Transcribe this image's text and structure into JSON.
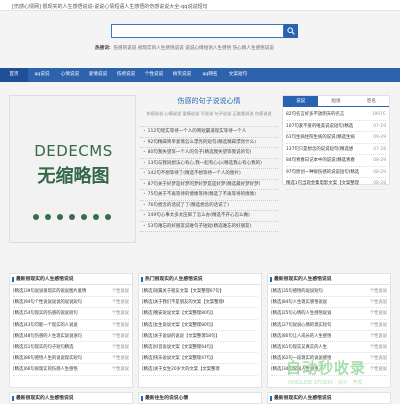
{
  "topbar": {
    "text": "[伤感心情网] 很现实的人生感悟说说-说说心情短语人生感悟的伤感说说大全-qq说说短句"
  },
  "search": {
    "placeholder": "",
    "button": "search-icon"
  },
  "hot": {
    "label": "热搜词：",
    "text": "伤感的说说 很现实的人生感悟说说 说说心情短语人生感悟 伤心情人生感悟说说"
  },
  "nav": {
    "items": [
      "首页",
      "qq说说",
      "心情说说",
      "爱情说说",
      "伤感说说",
      "个性说说",
      "搞笑说说",
      "qq网名",
      "文案短句"
    ]
  },
  "banner": {
    "line1": "DEDECMS",
    "line2": "无缩略图"
  },
  "featured": {
    "title": "伤感的句子说说心情",
    "tags": "伤感说说 心情说说 爱情说说 写说说 句子说说 正能量说说 伤感说说",
    "items": [
      "112句现实等待一个人的简短霸道现实等待一个人",
      "92句精辟简单爱情怎么漂亮的短句(精选精辟漂亮什么)",
      "80句我失望等一个人的句子(精选我失望等我说的句)",
      "13句与我同想法心有心,我一起有心心(精选我心有心我的)",
      "142句不想等待了(精选不想等待一个人的图片)",
      "87句关于好梦是好梦的梦好梦是是好梦(精选最好梦好梦)",
      "75句关于不再等待的情愫等待(精选了不再等待的情愫)",
      "76句想念的话说了了(精选想念的话说了)",
      "149句心事太多太压抑了怎么办(精选不开心怎么做)",
      "53句难忘的好朋友说难句子短短(精选难忘的好朋友)"
    ]
  },
  "side": {
    "tabs": [
      "说说",
      "短语",
      "签名"
    ],
    "items": [
      {
        "title": "82句名言好多不放明天的名言",
        "date": "1907C"
      },
      {
        "title": "107句爱不爱的唯美说说短句(精选",
        "date": "07-29"
      },
      {
        "title": "61句生病住院生病的说说(精选生病",
        "date": "09-29"
      },
      {
        "title": "137句只是想念的说说短句(精选想",
        "date": "07-28"
      },
      {
        "title": "84句青春日记本中的说说(精选青春",
        "date": "08-29"
      },
      {
        "title": "97句原创一种很伤感的说说短句(精选",
        "date": "08-29"
      },
      {
        "title": "精选1句当现金集电影文案【文案整理",
        "date": "08-28"
      }
    ]
  },
  "boxes": [
    {
      "title": "最新很现实的人生感悟说说",
      "items": [
        {
          "title": "[精选]39句说说很现实的说说图片爱情",
          "date": "个性说说"
        },
        {
          "title": "[精选]94句个性说说说说的说说短句",
          "date": "个性说说"
        },
        {
          "title": "[精选]54句现实的伤感的说说短句",
          "date": "个性说说"
        },
        {
          "title": "[精选]43句可能一个现实的人说说",
          "date": "个性说说"
        },
        {
          "title": "[精选]48句伤感的人生现实说说语句",
          "date": "个性说说"
        },
        {
          "title": "[精选]51句现实的句子短句精选",
          "date": "个性说说"
        },
        {
          "title": "[精选]86句感悟人生的说说现实短句",
          "date": "个性说说"
        },
        {
          "title": "[精选]66句很现实的伤感人生感悟",
          "date": "个性说说"
        }
      ]
    },
    {
      "title": "热门很现实的人生感悟说说",
      "items": [
        {
          "title": "[精选]短篇关于朋友文案【文案整理07句】",
          "date": ""
        },
        {
          "title": "[精选]关于我们不是朋友的文案【文案整理69句】",
          "date": ""
        },
        {
          "title": "[精选]晚安说说文案【文案整理80句】",
          "date": ""
        },
        {
          "title": "[精选]女生说说文案【文案整理80句】",
          "date": ""
        },
        {
          "title": "[精选]关于说说的说说【文案整理58句】",
          "date": ""
        },
        {
          "title": "[精选]抖音说说文案【文案整理64句】",
          "date": ""
        },
        {
          "title": "[精选]快乐说说文案【文案整理47句】",
          "date": ""
        },
        {
          "title": "[精选]关于女生20岁大的文案【文案整理",
          "date": ""
        }
      ]
    },
    {
      "title": "最新很现实的人生感悟说说",
      "items": [
        {
          "title": "[精选]35句感悟的说说短句",
          "date": "个性说说"
        },
        {
          "title": "[精选]84句人生现实感悟说说",
          "date": "个性说说"
        },
        {
          "title": "[精选]25句心情的人生感悟说说",
          "date": "个性说说"
        },
        {
          "title": "[精选]27句说说心情的现实短句",
          "date": "个性说说"
        },
        {
          "title": "[精选]80句让人成长的人生感悟",
          "date": "个性说说"
        },
        {
          "title": "[精选]61句现实又真实的人生",
          "date": "个性说说"
        },
        {
          "title": "[精选]62句一段现实的说说感悟",
          "date": "个性说说"
        },
        {
          "title": "[精选]34句说说人生感悟",
          "date": "个性说说"
        }
      ]
    }
  ],
  "bottom": [
    "最新很现实的人生感悟说说",
    "最新往生的说说心情",
    "最新很现实的人生感悟说说"
  ],
  "watermark": {
    "title": "自动秒收录",
    "sub": "QINGLIDE STUDIO · 设计 · 开发"
  }
}
